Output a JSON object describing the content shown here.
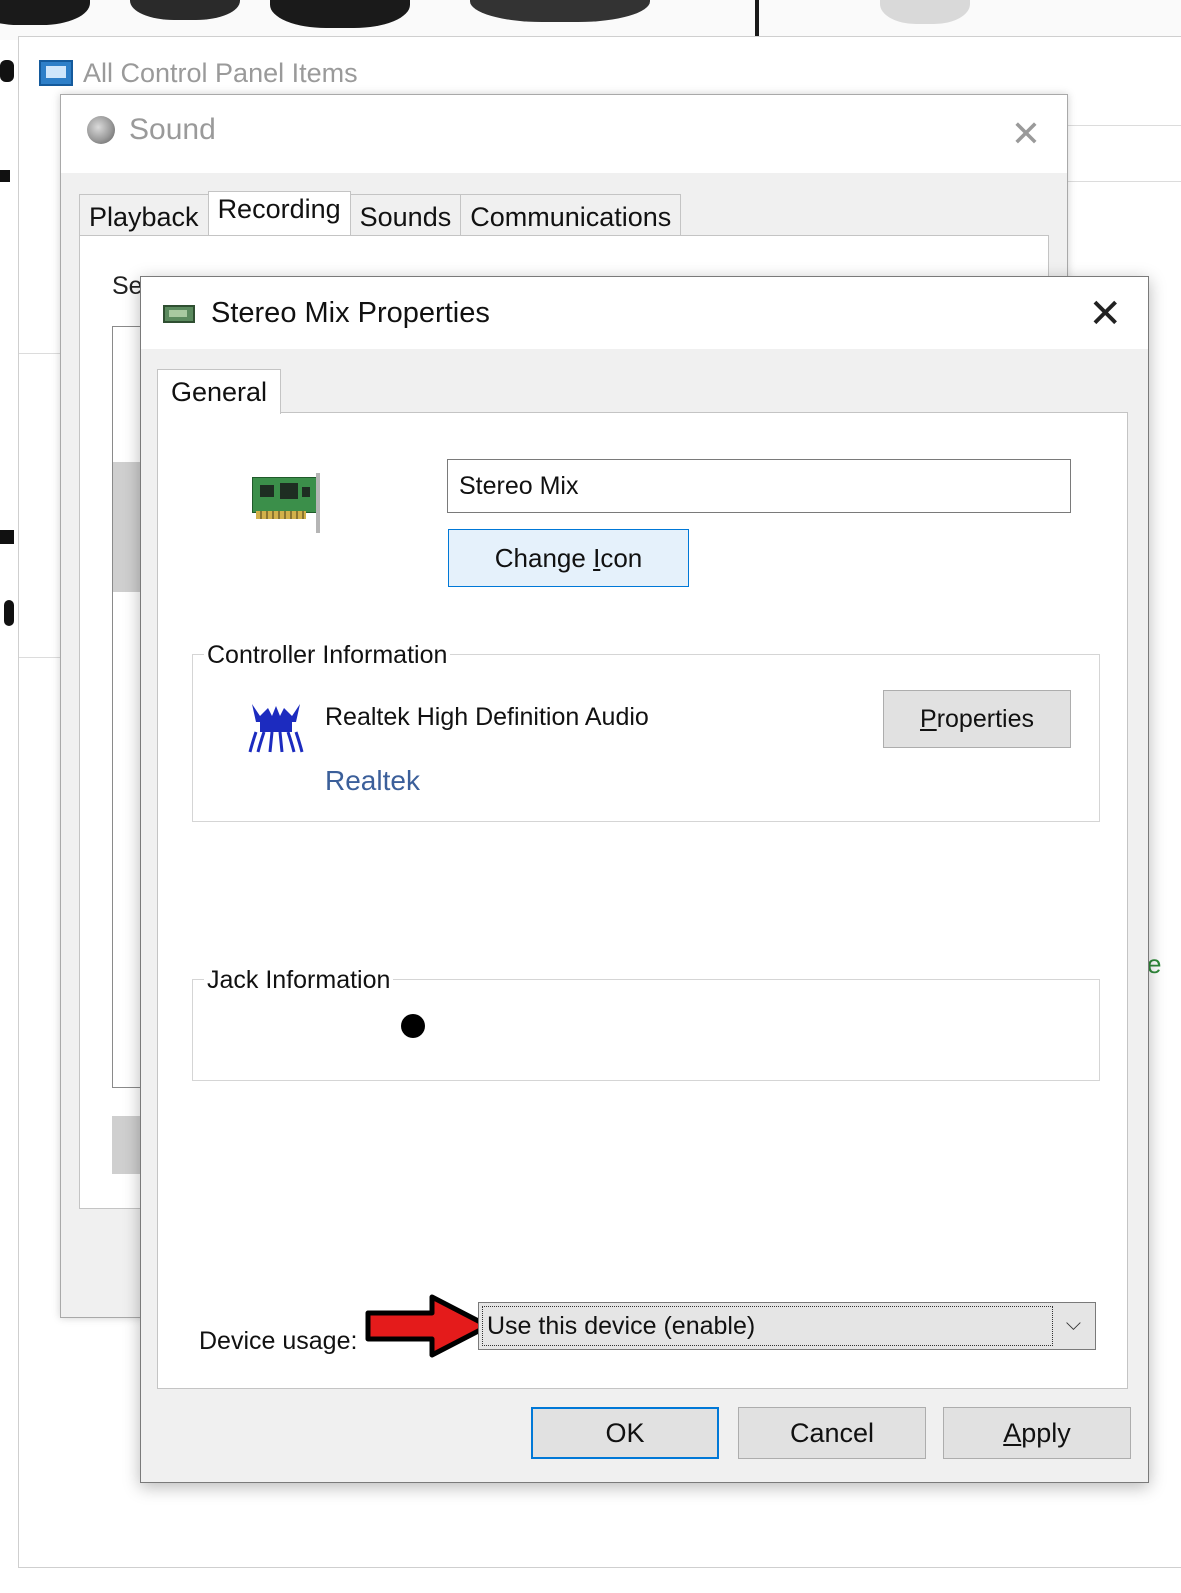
{
  "control_panel": {
    "title": "All Control Panel Items",
    "right_fragment": "e"
  },
  "sound_dialog": {
    "title": "Sound",
    "close_glyph": "✕",
    "tabs": [
      {
        "label": "Playback",
        "active": false
      },
      {
        "label": "Recording",
        "active": true
      },
      {
        "label": "Sounds",
        "active": false
      },
      {
        "label": "Communications",
        "active": false
      }
    ],
    "body_text_fragment": "Se"
  },
  "properties_dialog": {
    "title": "Stereo Mix Properties",
    "close_glyph": "✕",
    "tab_label": "General",
    "name_value": "Stereo Mix",
    "change_icon": {
      "pre": "Change ",
      "accel": "I",
      "post": "con"
    },
    "controller_group_label": "Controller Information",
    "controller_name": "Realtek High Definition Audio",
    "controller_link": "Realtek",
    "controller_properties": {
      "pre": "",
      "accel": "P",
      "post": "roperties"
    },
    "jack_group_label": "Jack Information",
    "device_usage_label": "Device usage:",
    "device_usage_value": "Use this device (enable)",
    "chevron_glyph": "⌵",
    "buttons": {
      "ok": "OK",
      "cancel": "Cancel",
      "apply": {
        "accel": "A",
        "post": "pply"
      }
    }
  },
  "icons": {
    "control_panel": "control-panel-icon",
    "sound": "speaker-icon",
    "sound_card": "sound-card-icon",
    "realtek": "realtek-logo-icon",
    "annotation": "red-arrow-icon"
  },
  "colors": {
    "accent": "#0078d7",
    "link": "#3b5f9a",
    "arrow": "#e41b1b"
  }
}
